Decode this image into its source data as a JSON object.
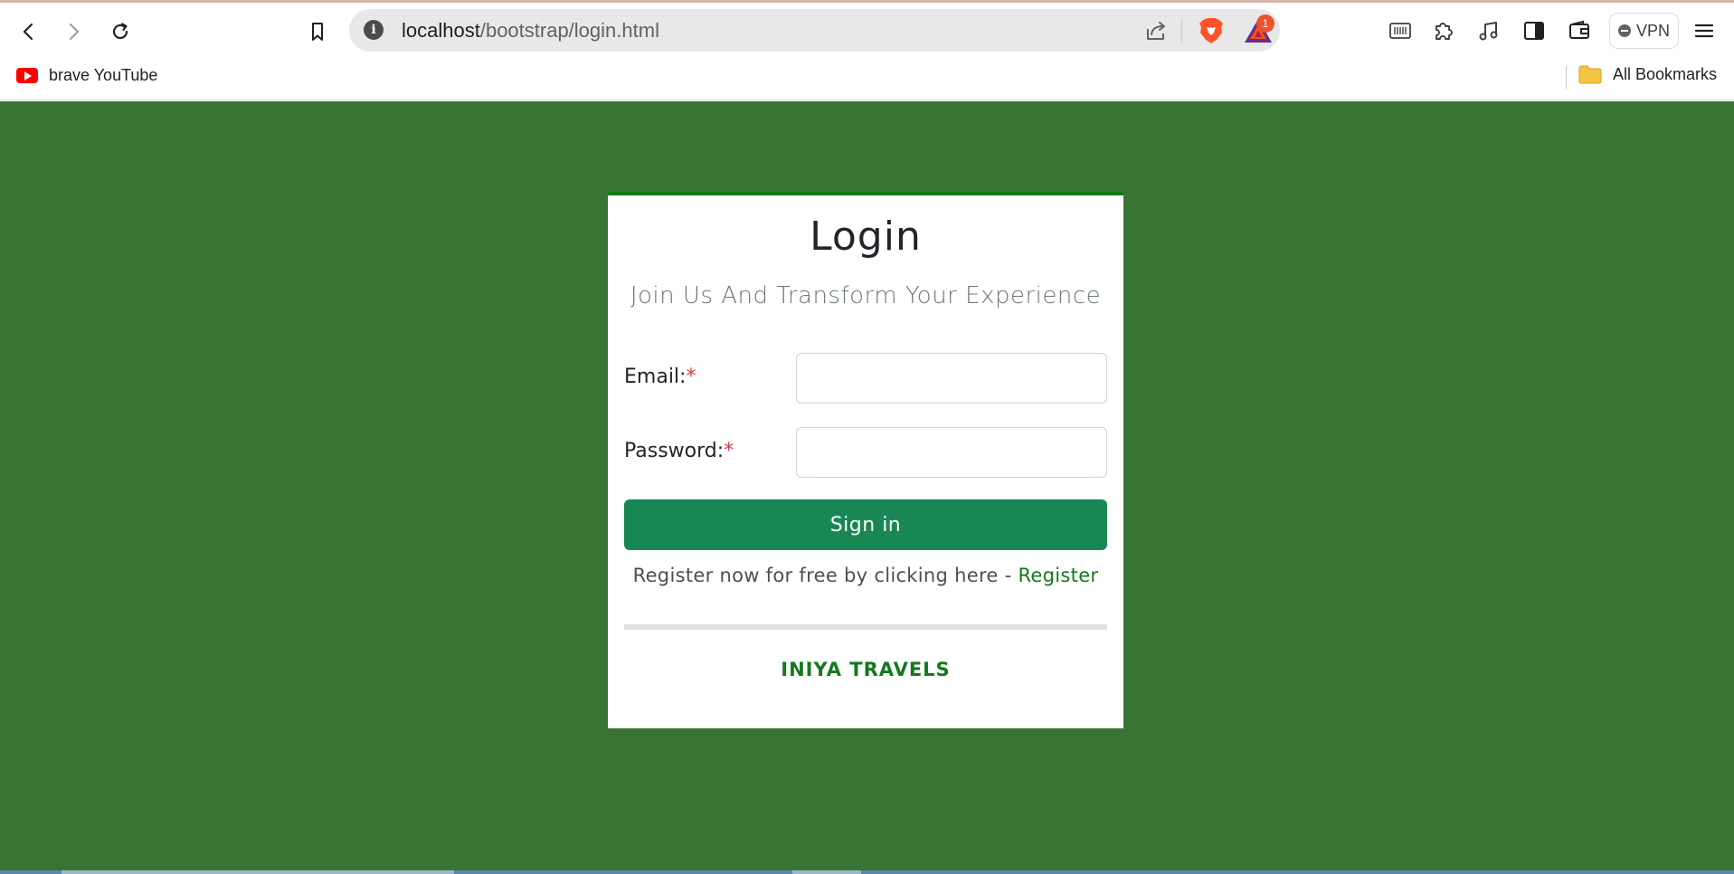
{
  "browser": {
    "url_host": "localhost",
    "url_path": "/bootstrap/login.html",
    "bat_badge_count": "1",
    "vpn_label": "VPN"
  },
  "bookmarks": {
    "items": [
      {
        "label": "brave YouTube",
        "icon": "youtube-icon"
      }
    ],
    "all_bookmarks_label": "All Bookmarks"
  },
  "login": {
    "title": "Login",
    "subtitle": "Join Us And Transform Your Experience",
    "email_label": "Email:",
    "password_label": "Password:",
    "required_mark": "*",
    "email_value": "",
    "password_value": "",
    "signin_label": "Sign in",
    "register_text": "Register now for free by clicking here - ",
    "register_link": "Register",
    "brand": "INIYA TRAVELS"
  },
  "colors": {
    "page_background": "#397435",
    "card_top_border": "#0f7a12",
    "signin_button": "#198754",
    "link_green": "#14791d",
    "required_red": "#dc3545"
  }
}
